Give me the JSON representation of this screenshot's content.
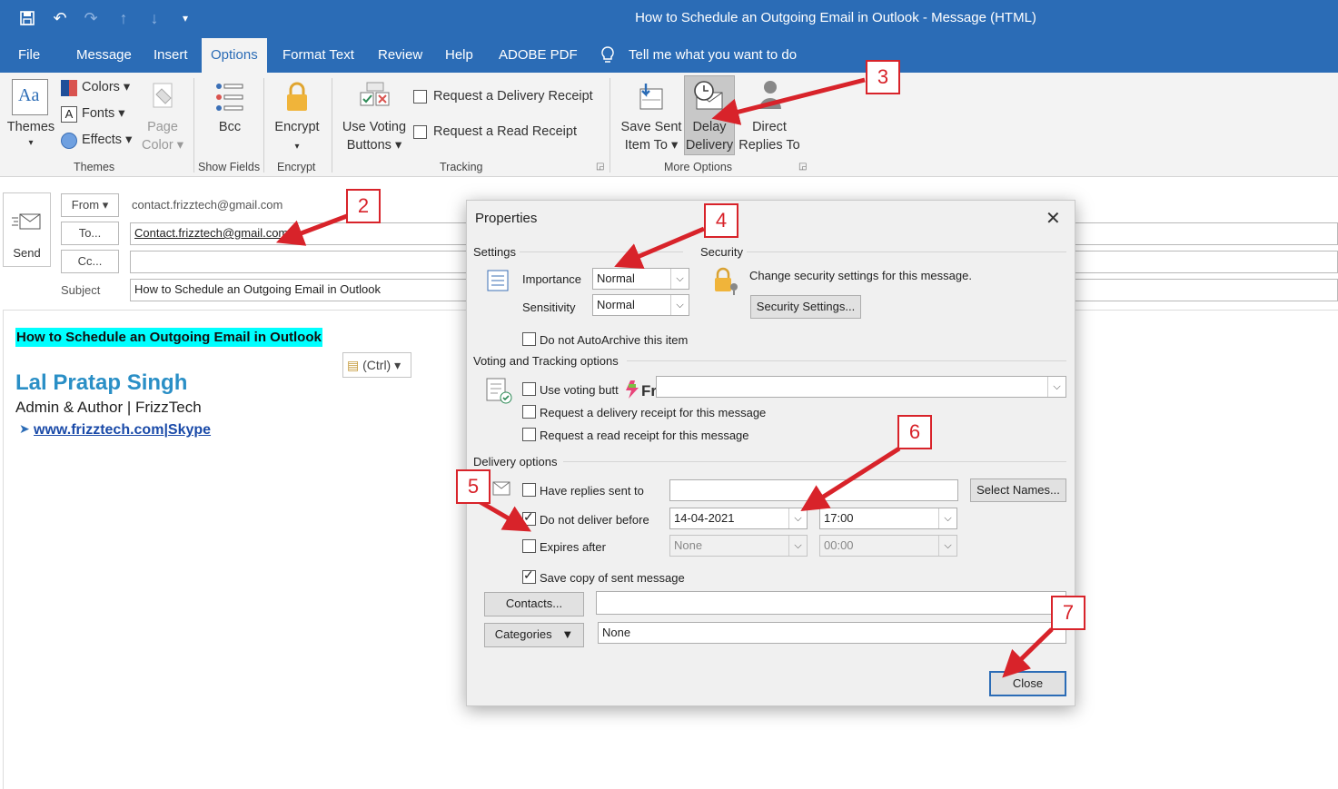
{
  "window": {
    "title": "How to Schedule an Outgoing Email in Outlook  -  Message (HTML)"
  },
  "menu": {
    "tabs": [
      "File",
      "Message",
      "Insert",
      "Options",
      "Format Text",
      "Review",
      "Help",
      "ADOBE PDF"
    ],
    "active": "Options",
    "tell_me": "Tell me what you want to do"
  },
  "ribbon": {
    "themes": {
      "themes_label": "Themes",
      "colors": "Colors",
      "fonts": "Fonts",
      "effects": "Effects",
      "page_color_1": "Page",
      "page_color_2": "Color",
      "group": "Themes"
    },
    "show_fields": {
      "bcc": "Bcc",
      "group": "Show Fields"
    },
    "encrypt": {
      "label": "Encrypt",
      "group": "Encrypt"
    },
    "tracking": {
      "voting_1": "Use Voting",
      "voting_2": "Buttons",
      "delivery_receipt": "Request a Delivery Receipt",
      "read_receipt": "Request a Read Receipt",
      "group": "Tracking"
    },
    "more_options": {
      "save_sent_1": "Save Sent",
      "save_sent_2": "Item To",
      "delay_1": "Delay",
      "delay_2": "Delivery",
      "direct_1": "Direct",
      "direct_2": "Replies To",
      "group": "More Options"
    }
  },
  "compose": {
    "send": "Send",
    "from_btn": "From",
    "from_value": "contact.frizztech@gmail.com",
    "to_btn": "To...",
    "to_value": "Contact.frizztech@gmail.com;",
    "cc_btn": "Cc...",
    "subject_label": "Subject",
    "subject_value": "How to Schedule an Outgoing Email in Outlook"
  },
  "body": {
    "heading": "How to Schedule an Outgoing Email in Outlook",
    "paste_ctrl": "(Ctrl)",
    "sig_name": "Lal Pratap Singh",
    "sig_role": "Admin & Author | FrizzTech",
    "sig_link1": "www.frizztech.com",
    "sig_sep": "|",
    "sig_link2": "Skype"
  },
  "dialog": {
    "title": "Properties",
    "settings": "Settings",
    "importance_label": "Importance",
    "importance_value": "Normal",
    "sensitivity_label": "Sensitivity",
    "sensitivity_value": "Normal",
    "security": "Security",
    "security_text": "Change security settings for this message.",
    "security_btn": "Security Settings...",
    "autoarchive": "Do not AutoArchive this item",
    "voting_section": "Voting and Tracking options",
    "use_voting": "Use voting butt",
    "watermark": "FrizzTech",
    "delivery_receipt": "Request a delivery receipt for this message",
    "read_receipt": "Request a read receipt for this message",
    "delivery_section": "Delivery options",
    "have_replies": "Have replies sent to",
    "select_names": "Select Names...",
    "do_not_deliver": "Do not deliver before",
    "deliver_date": "14-04-2021",
    "deliver_time": "17:00",
    "expires": "Expires after",
    "expires_date": "None",
    "expires_time": "00:00",
    "save_copy": "Save copy of sent message",
    "contacts_btn": "Contacts...",
    "categories_btn": "Categories",
    "categories_value": "None",
    "close_btn": "Close"
  },
  "callouts": [
    "2",
    "3",
    "4",
    "5",
    "6",
    "7"
  ],
  "colors": {
    "brand": "#2b6cb6",
    "highlight": "#00ffff",
    "signature": "#2a8fc6",
    "callout": "#d8232a"
  }
}
